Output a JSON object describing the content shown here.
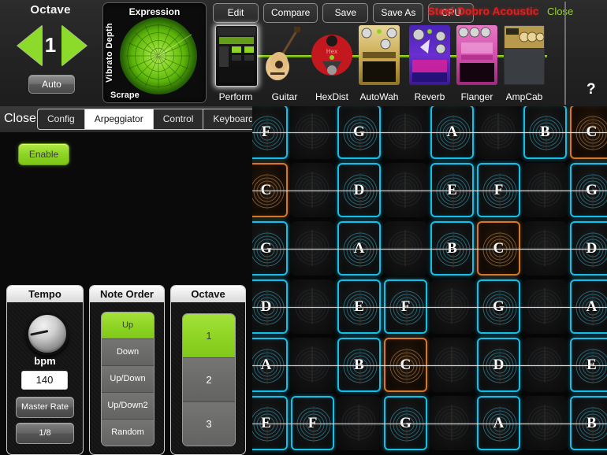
{
  "octave": {
    "title": "Octave",
    "value": "1",
    "auto_label": "Auto",
    "prev_icon": "triangle-left-icon",
    "next_icon": "triangle-right-icon"
  },
  "expression": {
    "title": "Expression",
    "y_axis_label": "Vibrato Depth",
    "x_axis_label": "Scrape"
  },
  "toolbar": {
    "buttons": [
      {
        "label": "Edit"
      },
      {
        "label": "Compare"
      },
      {
        "label": "Save"
      },
      {
        "label": "Save As"
      },
      {
        "label": "CPU"
      }
    ],
    "preset_name": "Steel Dobro Acoustic",
    "preset_color": "#e02020",
    "close_label": "Close",
    "close_color": "#9ad32c",
    "help_label": "?"
  },
  "chain": {
    "pedals": [
      {
        "label": "Perform",
        "selected": true
      },
      {
        "label": "Guitar",
        "selected": false
      },
      {
        "label": "HexDist",
        "selected": false
      },
      {
        "label": "AutoWah",
        "selected": false
      },
      {
        "label": "Reverb",
        "selected": false
      },
      {
        "label": "Flanger",
        "selected": false
      },
      {
        "label": "AmpCab",
        "selected": false
      }
    ],
    "wire_color": "#8cdb2a"
  },
  "panel": {
    "close_label": "Close",
    "tabs": [
      {
        "label": "Config",
        "active": false
      },
      {
        "label": "Arpeggiator",
        "active": true
      },
      {
        "label": "Control",
        "active": false
      },
      {
        "label": "Keyboard",
        "active": false
      }
    ],
    "enable_label": "Enable",
    "enable_on": true,
    "tempo": {
      "title": "Tempo",
      "knob_name": "tempo-knob",
      "bpm_label": "bpm",
      "bpm_value": "140",
      "master_rate_label": "Master Rate",
      "rate_label": "1/8"
    },
    "note_order": {
      "title": "Note Order",
      "options": [
        "Up",
        "Down",
        "Up/Down",
        "Up/Down2",
        "Random"
      ],
      "selected": "Up"
    },
    "octave_group": {
      "title": "Octave",
      "options": [
        "1",
        "2",
        "3"
      ],
      "selected": "1"
    }
  },
  "fretboard": {
    "accent_on": "#16bfe8",
    "accent_root": "#d2792b",
    "rows": [
      {
        "cells": [
          {
            "note": "F",
            "state": "on"
          },
          {
            "note": "",
            "state": "off"
          },
          {
            "note": "G",
            "state": "on"
          },
          {
            "note": "",
            "state": "off"
          },
          {
            "note": "A",
            "state": "on"
          },
          {
            "note": "",
            "state": "off"
          },
          {
            "note": "B",
            "state": "on"
          },
          {
            "note": "C",
            "state": "root"
          }
        ]
      },
      {
        "cells": [
          {
            "note": "C",
            "state": "root"
          },
          {
            "note": "",
            "state": "off"
          },
          {
            "note": "D",
            "state": "on"
          },
          {
            "note": "",
            "state": "off"
          },
          {
            "note": "E",
            "state": "on"
          },
          {
            "note": "F",
            "state": "on"
          },
          {
            "note": "",
            "state": "off"
          },
          {
            "note": "G",
            "state": "on"
          }
        ]
      },
      {
        "cells": [
          {
            "note": "G",
            "state": "on"
          },
          {
            "note": "",
            "state": "off"
          },
          {
            "note": "A",
            "state": "on"
          },
          {
            "note": "",
            "state": "off"
          },
          {
            "note": "B",
            "state": "on"
          },
          {
            "note": "C",
            "state": "root"
          },
          {
            "note": "",
            "state": "off"
          },
          {
            "note": "D",
            "state": "on"
          }
        ]
      },
      {
        "cells": [
          {
            "note": "D",
            "state": "on"
          },
          {
            "note": "",
            "state": "off"
          },
          {
            "note": "E",
            "state": "on"
          },
          {
            "note": "F",
            "state": "on"
          },
          {
            "note": "",
            "state": "off"
          },
          {
            "note": "G",
            "state": "on"
          },
          {
            "note": "",
            "state": "off"
          },
          {
            "note": "A",
            "state": "on"
          }
        ]
      },
      {
        "cells": [
          {
            "note": "A",
            "state": "on"
          },
          {
            "note": "",
            "state": "off"
          },
          {
            "note": "B",
            "state": "on"
          },
          {
            "note": "C",
            "state": "root"
          },
          {
            "note": "",
            "state": "off"
          },
          {
            "note": "D",
            "state": "on"
          },
          {
            "note": "",
            "state": "off"
          },
          {
            "note": "E",
            "state": "on"
          }
        ]
      },
      {
        "cells": [
          {
            "note": "E",
            "state": "on"
          },
          {
            "note": "F",
            "state": "on"
          },
          {
            "note": "",
            "state": "off"
          },
          {
            "note": "G",
            "state": "on"
          },
          {
            "note": "",
            "state": "off"
          },
          {
            "note": "A",
            "state": "on"
          },
          {
            "note": "",
            "state": "off"
          },
          {
            "note": "B",
            "state": "on"
          }
        ]
      }
    ]
  }
}
